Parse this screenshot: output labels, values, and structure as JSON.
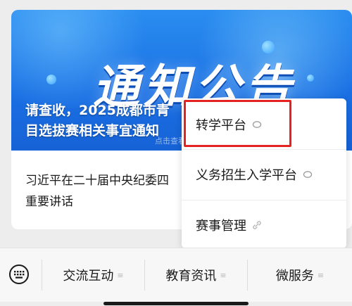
{
  "banner": {
    "title": "通知公告",
    "caption": "请查收，2025成都市青少年科技创新大赛项目选拔赛相关事宜通知",
    "caption_visible_line1": "请查收，2025成都市青",
    "caption_visible_line2": "目选拔赛相关事宜通知",
    "hint": "点击查看"
  },
  "article": {
    "line1": "习近平在二十届中央纪委四",
    "line2": "重要讲话"
  },
  "menu": {
    "items": [
      {
        "label": "转学平台",
        "icon": "mini-program-icon",
        "highlighted": true
      },
      {
        "label": "义务招生入学平台",
        "icon": "mini-program-icon"
      },
      {
        "label": "赛事管理",
        "icon": "link-icon"
      }
    ]
  },
  "tabbar": {
    "keyboard_icon": "keyboard-icon",
    "tabs": [
      {
        "label": "交流互动",
        "menu_marker": "≡"
      },
      {
        "label": "教育资讯",
        "menu_marker": "≡"
      },
      {
        "label": "微服务",
        "menu_marker": "≡"
      }
    ]
  },
  "colors": {
    "highlight": "#e52222",
    "banner_blue": "#1a6fe3",
    "background": "#ededed"
  }
}
